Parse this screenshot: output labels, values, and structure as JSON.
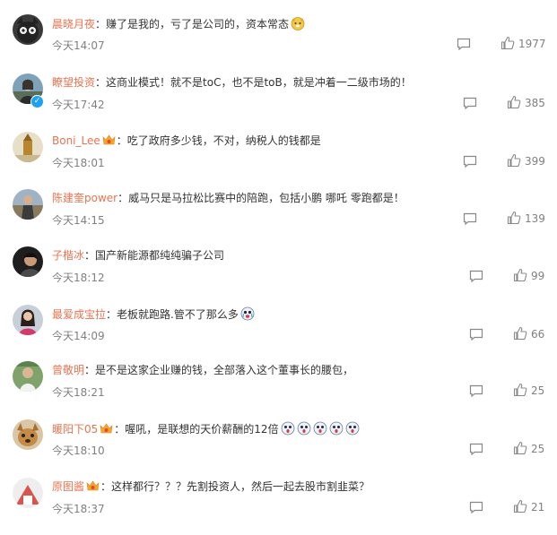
{
  "comments": [
    {
      "user": "晨晓月夜",
      "text": "赚了是我的，亏了是公司的，资本常态",
      "time": "今天14:07",
      "likes": "1977"
    },
    {
      "user": "瞭望投资",
      "text": "这商业模式！就不是toC，也不是toB，就是冲着一二级市场的！",
      "time": "今天17:42",
      "likes": "385"
    },
    {
      "user": "Boni_Lee",
      "text": "吃了政府多少钱，不对，纳税人的钱都是",
      "time": "今天18:01",
      "likes": "399"
    },
    {
      "user": "陈建奎power",
      "text": "威马只是马拉松比赛中的陪跑，包括小鹏 哪吒 零跑都是！",
      "time": "今天14:15",
      "likes": "139"
    },
    {
      "user": "子楷冰",
      "text": "国产新能源都纯纯骗子公司",
      "time": "今天18:12",
      "likes": "99"
    },
    {
      "user": "最爱成宝拉",
      "text": "老板就跑路.管不了那么多",
      "time": "今天14:09",
      "likes": "66"
    },
    {
      "user": "曾敬明",
      "text": "是不是这家企业赚的钱，全部落入这个董事长的腰包，",
      "time": "今天18:21",
      "likes": "25"
    },
    {
      "user": "暖阳下05",
      "text": "喔吼，是联想的天价薪酬的12倍",
      "time": "今天18:10",
      "likes": "25"
    },
    {
      "user": "原图酱",
      "text": "这样都行？？？先割投资人，然后一起去股市割韭菜？",
      "time": "今天18:37",
      "likes": "21"
    }
  ],
  "colors": {
    "username": "#eb7350",
    "meta": "#808080",
    "text": "#333333"
  },
  "icons": {
    "reply": "comment-icon",
    "like": "thumbs-up-icon"
  }
}
